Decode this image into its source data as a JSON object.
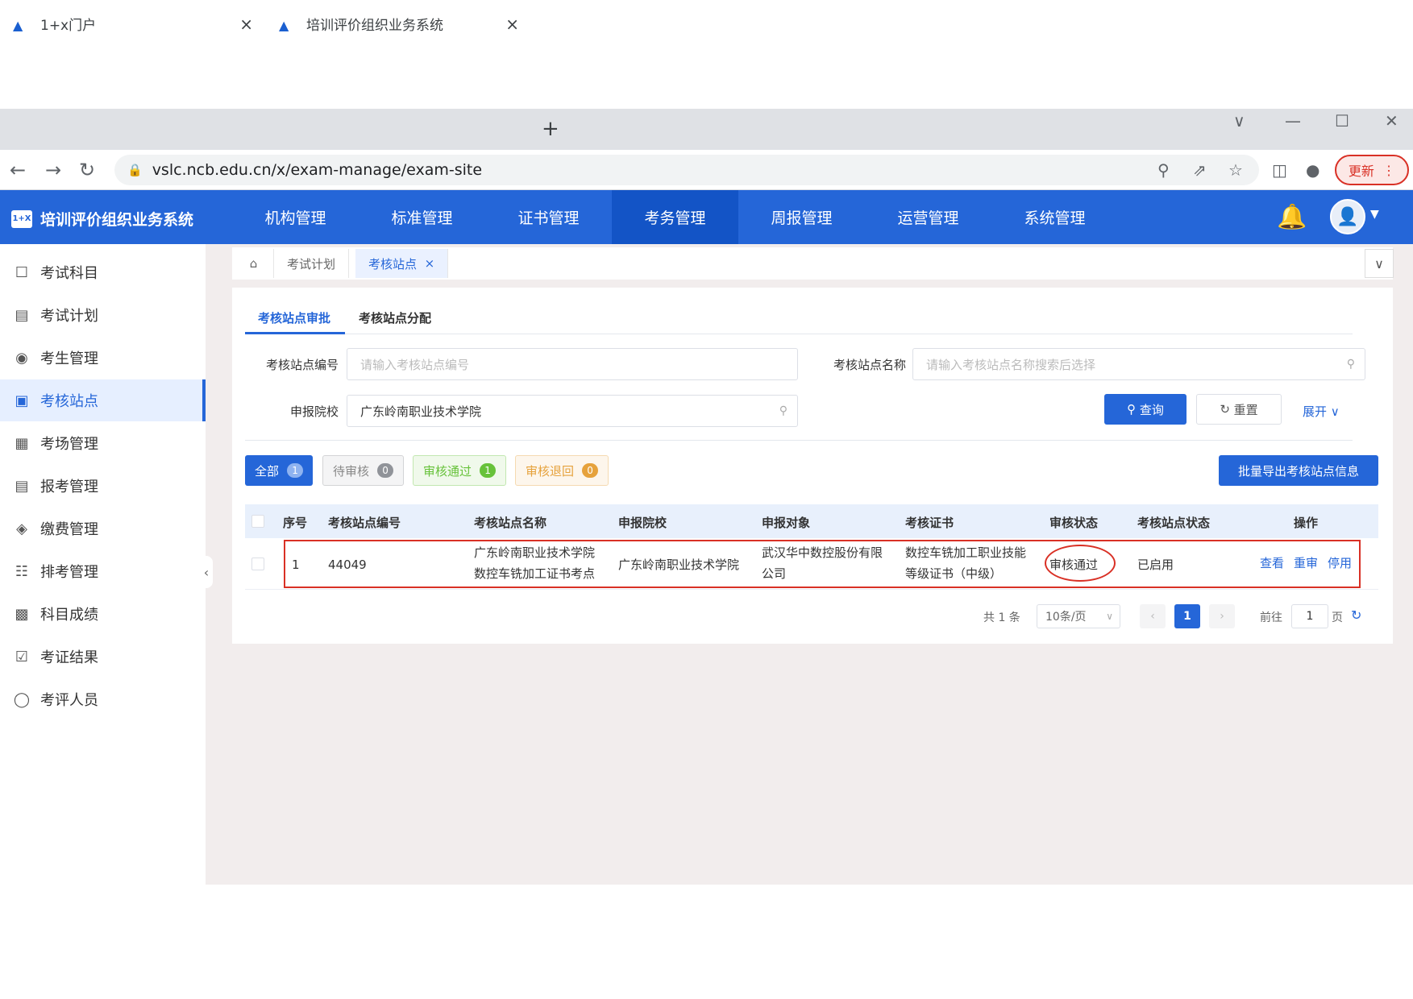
{
  "browser": {
    "tabs": [
      {
        "title": "1+x门户"
      },
      {
        "title": "培训评价组织业务系统"
      }
    ],
    "url": "vslc.ncb.edu.cn/x/exam-manage/exam-site",
    "update_label": "更新"
  },
  "app": {
    "title": "培训评价组织业务系统",
    "logo_text": "1+X",
    "top_nav": [
      "机构管理",
      "标准管理",
      "证书管理",
      "考务管理",
      "周报管理",
      "运营管理",
      "系统管理"
    ],
    "active_nav": "考务管理"
  },
  "sidebar": {
    "items": [
      {
        "label": "考试科目",
        "icon": "subject-icon"
      },
      {
        "label": "考试计划",
        "icon": "plan-icon"
      },
      {
        "label": "考生管理",
        "icon": "candidate-icon"
      },
      {
        "label": "考核站点",
        "icon": "site-icon"
      },
      {
        "label": "考场管理",
        "icon": "room-icon"
      },
      {
        "label": "报考管理",
        "icon": "register-icon"
      },
      {
        "label": "缴费管理",
        "icon": "payment-icon"
      },
      {
        "label": "排考管理",
        "icon": "schedule-icon"
      },
      {
        "label": "科目成绩",
        "icon": "score-icon"
      },
      {
        "label": "考证结果",
        "icon": "result-icon"
      },
      {
        "label": "考评人员",
        "icon": "staff-icon"
      }
    ],
    "active": "考核站点"
  },
  "page_tags": [
    {
      "label": "考试计划"
    },
    {
      "label": "考核站点"
    }
  ],
  "sub_tabs": [
    "考核站点审批",
    "考核站点分配"
  ],
  "filters": {
    "site_code": {
      "label": "考核站点编号",
      "placeholder": "请输入考核站点编号"
    },
    "site_name": {
      "label": "考核站点名称",
      "placeholder": "请输入考核站点名称搜索后选择"
    },
    "school": {
      "label": "申报院校",
      "value": "广东岭南职业技术学院"
    },
    "query_label": "查询",
    "reset_label": "重置",
    "expand_label": "展开"
  },
  "status_chips": [
    {
      "label": "全部",
      "count": "1"
    },
    {
      "label": "待审核",
      "count": "0"
    },
    {
      "label": "审核通过",
      "count": "1"
    },
    {
      "label": "审核退回",
      "count": "0"
    }
  ],
  "export_label": "批量导出考核站点信息",
  "table": {
    "headers": [
      "序号",
      "考核站点编号",
      "考核站点名称",
      "申报院校",
      "申报对象",
      "考核证书",
      "审核状态",
      "考核站点状态",
      "操作"
    ],
    "rows": [
      {
        "index": "1",
        "code": "44049",
        "name_line1": "广东岭南职业技术学院",
        "name_line2": "数控车铣加工证书考点",
        "school": "广东岭南职业技术学院",
        "target_line1": "武汉华中数控股份有限",
        "target_line2": "公司",
        "cert_line1": "数控车铣加工职业技能",
        "cert_line2": "等级证书（中级）",
        "audit_status": "审核通过",
        "site_status": "已启用",
        "actions": [
          "查看",
          "重审",
          "停用"
        ]
      }
    ]
  },
  "pagination": {
    "total": "共 1 条",
    "page_size": "10条/页",
    "current": "1",
    "goto_label": "前往",
    "goto_value": "1",
    "page_unit": "页"
  },
  "colors": {
    "brand": "#2566d8",
    "highlight": "#d93025",
    "pass": "#67c23a",
    "warning": "#e6a23c"
  }
}
